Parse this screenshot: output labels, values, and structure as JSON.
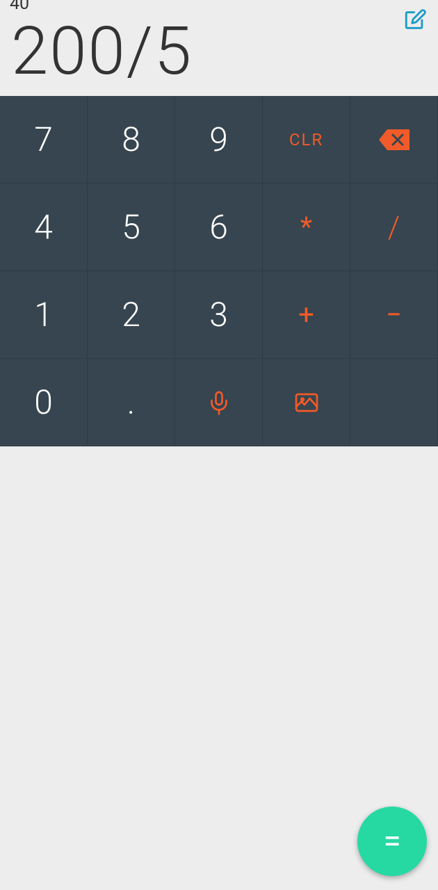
{
  "display": {
    "expression": "200/5",
    "result": "40"
  },
  "keys": {
    "r1c1": "7",
    "r1c2": "8",
    "r1c3": "9",
    "r1c4": "CLR",
    "r2c1": "4",
    "r2c2": "5",
    "r2c3": "6",
    "r2c4": "*",
    "r2c5": "/",
    "r3c1": "1",
    "r3c2": "2",
    "r3c3": "3",
    "r3c4": "+",
    "r3c5": "−",
    "r4c1": "0",
    "r4c2": ".",
    "equals": "="
  },
  "icons": {
    "edit": "edit-icon",
    "backspace": "backspace-icon",
    "mic": "mic-icon",
    "image": "image-icon"
  },
  "colors": {
    "accent": "#f15a29",
    "fab": "#26d9a3",
    "edit_stroke": "#1a9cc7"
  }
}
